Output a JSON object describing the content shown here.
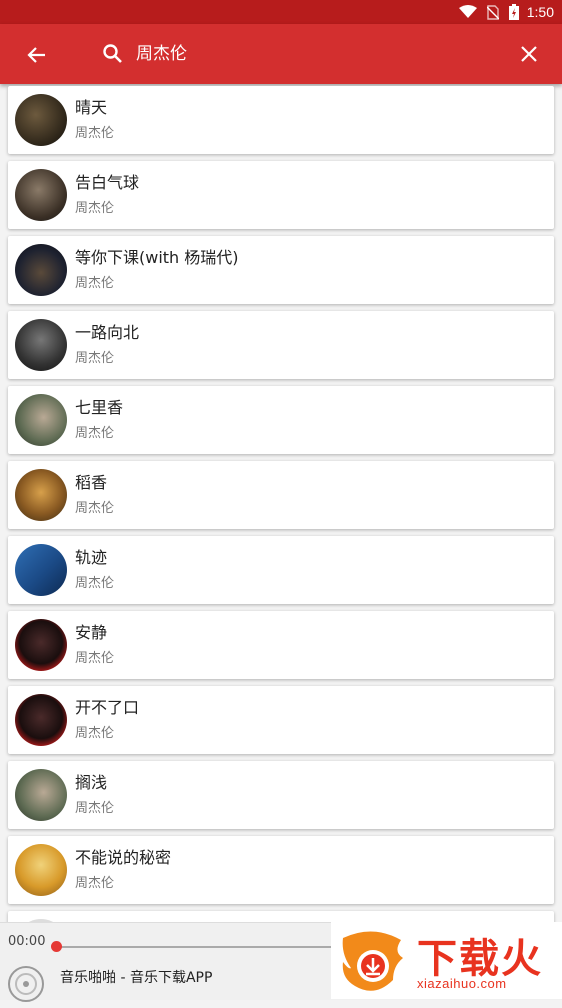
{
  "status_bar": {
    "time": "1:50",
    "icons": [
      "wifi-icon",
      "no-sim-icon",
      "battery-charging-icon"
    ]
  },
  "app_bar": {
    "back_icon": "arrow-left-icon",
    "search_icon": "search-icon",
    "query": "周杰伦",
    "close_icon": "close-icon"
  },
  "songs": [
    {
      "title": "晴天",
      "artist": "周杰伦"
    },
    {
      "title": "告白气球",
      "artist": "周杰伦"
    },
    {
      "title": "等你下课(with 杨瑞代)",
      "artist": "周杰伦"
    },
    {
      "title": "一路向北",
      "artist": "周杰伦"
    },
    {
      "title": "七里香",
      "artist": "周杰伦"
    },
    {
      "title": "稻香",
      "artist": "周杰伦"
    },
    {
      "title": "轨迹",
      "artist": "周杰伦"
    },
    {
      "title": "安静",
      "artist": "周杰伦"
    },
    {
      "title": "开不了口",
      "artist": "周杰伦"
    },
    {
      "title": "搁浅",
      "artist": "周杰伦"
    },
    {
      "title": "不能说的秘密",
      "artist": "周杰伦"
    }
  ],
  "player": {
    "current_time": "00:00",
    "progress": 0,
    "now_playing": "音乐啪啪 - 音乐下载APP",
    "disc_icon": "disc-icon"
  },
  "watermark": {
    "logo_text": "下载火",
    "url": "xiazaihuo.com"
  },
  "colors": {
    "primary": "#d32f2f",
    "status_bar": "#b71c1c",
    "accent": "#e53935"
  }
}
